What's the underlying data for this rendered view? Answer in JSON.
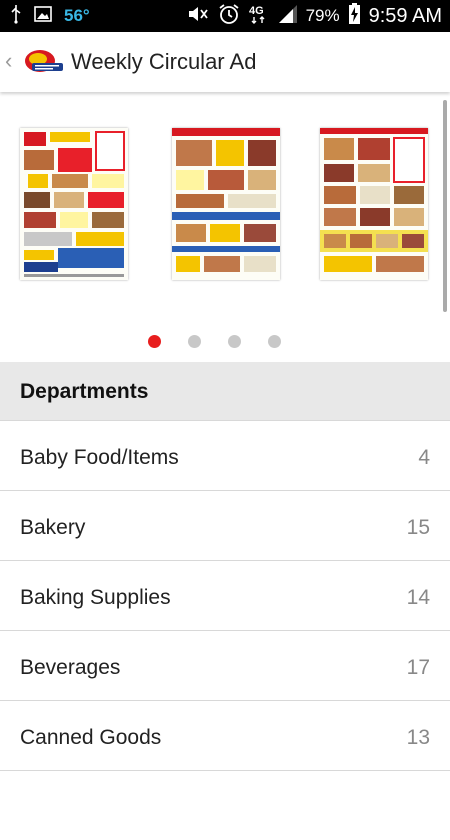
{
  "status_bar": {
    "temperature": "56°",
    "battery_percent": "79%",
    "time": "9:59 AM",
    "network": "4G",
    "icons": [
      "usb-icon",
      "image-icon",
      "mute-icon",
      "alarm-icon",
      "signal-icon",
      "battery-charging-icon"
    ]
  },
  "action_bar": {
    "title": "Weekly Circular Ad",
    "back_icon": "chevron-left-icon",
    "logo": "store-logo"
  },
  "carousel": {
    "page_count": 4,
    "active_index": 0,
    "pages": [
      {
        "name": "circular-page-1",
        "accent": "#e8202a"
      },
      {
        "name": "circular-page-2",
        "accent": "#2a5fb5"
      },
      {
        "name": "circular-page-3",
        "accent": "#e8202a"
      }
    ],
    "active_dot_color": "#e81e1e",
    "inactive_dot_color": "#c8c8c8"
  },
  "departments": {
    "header": "Departments",
    "items": [
      {
        "name": "Baby Food/Items",
        "count": "4"
      },
      {
        "name": "Bakery",
        "count": "15"
      },
      {
        "name": "Baking Supplies",
        "count": "14"
      },
      {
        "name": "Beverages",
        "count": "17"
      },
      {
        "name": "Canned Goods",
        "count": "13"
      }
    ]
  }
}
